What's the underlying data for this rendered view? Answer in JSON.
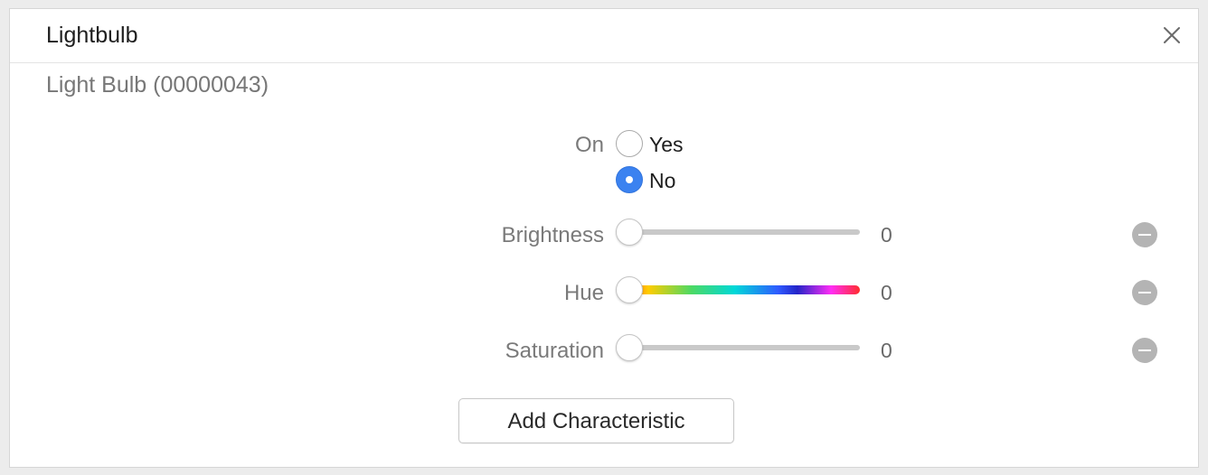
{
  "window": {
    "title": "Lightbulb",
    "close_icon": "close-icon"
  },
  "service": {
    "name": "Light Bulb (00000043)"
  },
  "characteristics": {
    "on": {
      "label": "On",
      "options": [
        "Yes",
        "No"
      ],
      "selected": "No"
    },
    "brightness": {
      "label": "Brightness",
      "value": "0",
      "slider_fraction": 0
    },
    "hue": {
      "label": "Hue",
      "value": "0",
      "slider_fraction": 0
    },
    "saturation": {
      "label": "Saturation",
      "value": "0",
      "slider_fraction": 0
    }
  },
  "actions": {
    "add_characteristic_label": "Add Characteristic",
    "remove_icon": "minus-circle-icon"
  },
  "colors": {
    "radio_selected": "#3b82f0",
    "remove_button": "#b4b4b4"
  }
}
